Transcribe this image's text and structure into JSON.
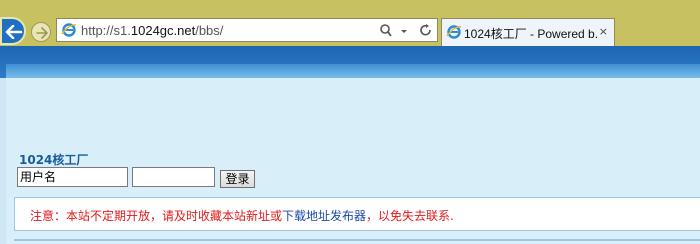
{
  "browser": {
    "url_prefix": "http://s1.",
    "url_host": "1024gc.net",
    "url_suffix": "/bbs/",
    "tab_title": "1024核工厂 - Powered b...",
    "tab_close": "×"
  },
  "page": {
    "site_name": "1024核工厂",
    "login": {
      "username_placeholder": "用户名",
      "button_label": "登录"
    },
    "notice": {
      "text_before": "注意：本站不定期开放，请及时收藏本站新址或",
      "link_text": "下载地址发布器",
      "text_after": "，以免失去联系."
    }
  },
  "colors": {
    "chrome_bg": "#c7c25f",
    "page_bg": "#d8eef9",
    "header_band": "#1f66b1",
    "notice_text": "#e11a1a",
    "link": "#1a4aa8",
    "site_name": "#1a5c9a"
  }
}
